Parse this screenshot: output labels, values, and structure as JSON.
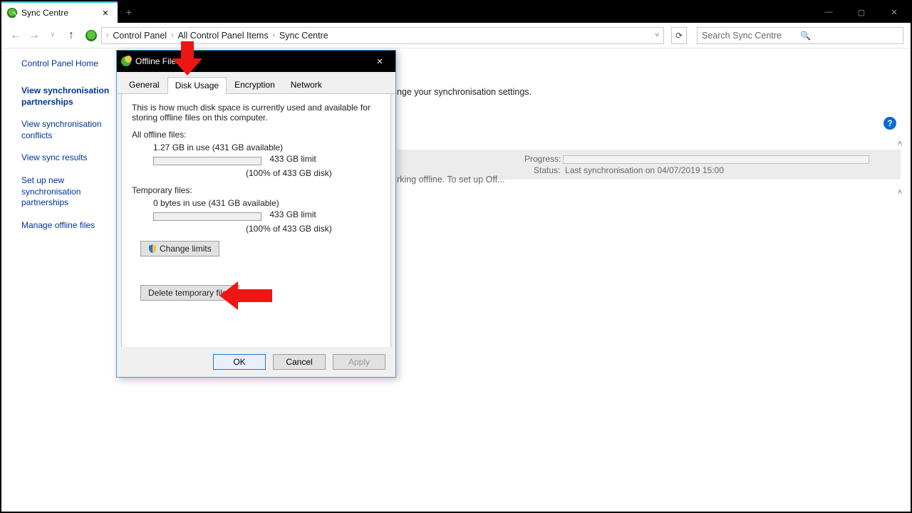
{
  "window": {
    "tab_title": "Sync Centre",
    "new_tab": "+"
  },
  "breadcrumb": {
    "parts": [
      "Control Panel",
      "All Control Panel Items",
      "Sync Centre"
    ]
  },
  "search": {
    "placeholder": "Search Sync Centre"
  },
  "sidebar": {
    "home": "Control Panel Home",
    "items": [
      "View synchronisation partnerships",
      "View synchronisation conflicts",
      "View sync results",
      "Set up new synchronisation partnerships",
      "Manage offline files"
    ]
  },
  "main": {
    "desc_tail": "nge your synchronisation settings.",
    "row_tail": "rking offline. To set up Off...",
    "progress_label": "Progress:",
    "status_label": "Status:",
    "status_value": "Last synchronisation on 04/07/2019 15:00"
  },
  "dialog": {
    "title": "Offline Files",
    "tabs": [
      "General",
      "Disk Usage",
      "Encryption",
      "Network"
    ],
    "active_tab": "Disk Usage",
    "description": "This is how much disk space is currently used and available for storing offline files on this computer.",
    "all_label": "All offline files:",
    "all_usage": "1.27 GB in use (431 GB available)",
    "all_limit": "433 GB limit",
    "all_pct": "(100% of 433 GB disk)",
    "temp_label": "Temporary files:",
    "temp_usage": "0 bytes in use (431 GB available)",
    "temp_limit": "433 GB limit",
    "temp_pct": "(100% of 433 GB disk)",
    "change_limits": "Change limits",
    "delete_temp": "Delete temporary files",
    "ok": "OK",
    "cancel": "Cancel",
    "apply": "Apply"
  }
}
